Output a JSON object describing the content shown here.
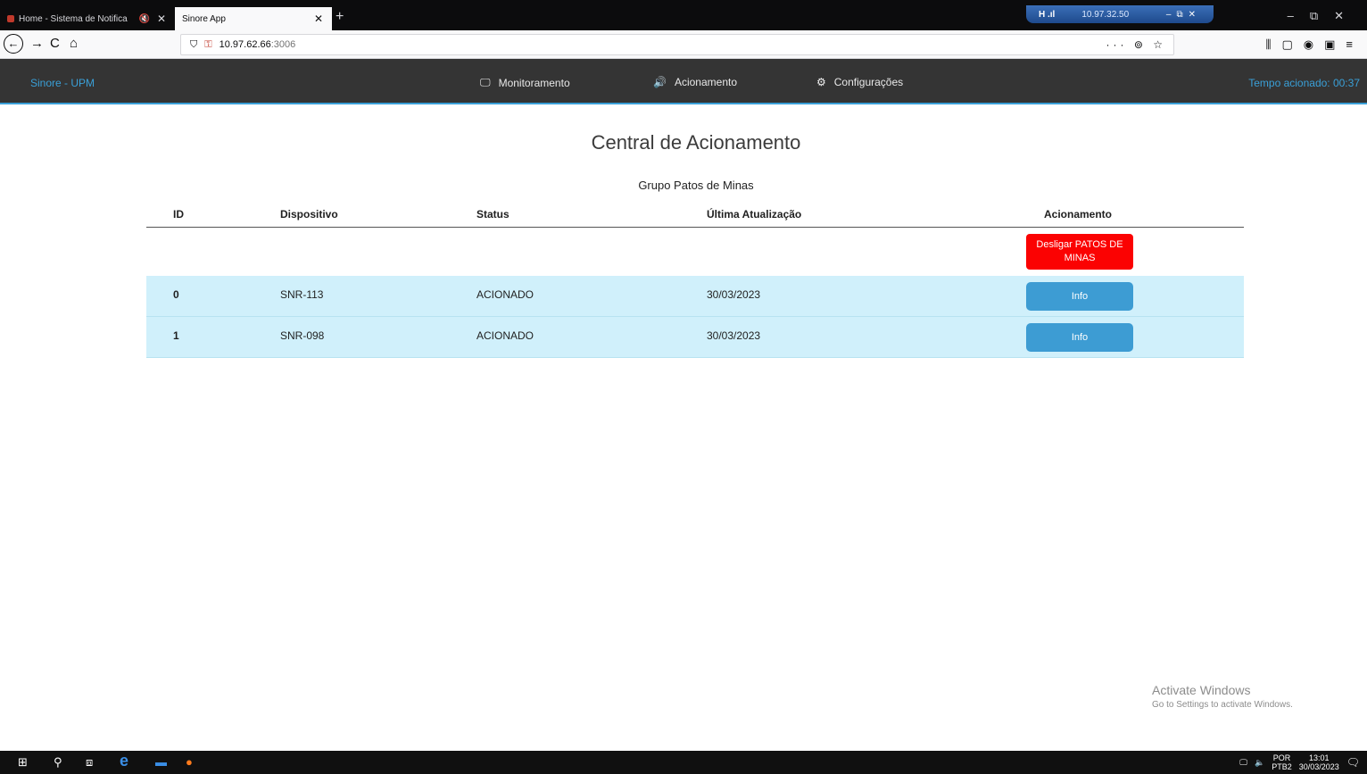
{
  "browser": {
    "tabs": [
      {
        "label": "Home - Sistema de Notifica",
        "active": false
      },
      {
        "label": "Sinore App",
        "active": true
      }
    ],
    "new_tab_icon": "+",
    "url_host": "10.97.62.66",
    "url_port": ":3006",
    "url_actions": "··· ⊚ ☆"
  },
  "remote_session": {
    "signal": "H .ıl",
    "ip": "10.97.32.50"
  },
  "app": {
    "brand": "Sinore - UPM",
    "nav": [
      {
        "label": "Monitoramento",
        "icon": "monitor-icon"
      },
      {
        "label": "Acionamento",
        "icon": "speaker-icon"
      },
      {
        "label": "Configurações",
        "icon": "gear-icon"
      }
    ],
    "timer": "Tempo acionado: 00:37"
  },
  "main": {
    "title": "Central de Acionamento",
    "group": "Grupo Patos de Minas",
    "columns": [
      "ID",
      "Dispositivo",
      "Status",
      "Última Atualização",
      "Acionamento"
    ],
    "shutdown_button": "Desligar PATOS DE MINAS",
    "rows": [
      {
        "id": "0",
        "device": "SNR-113",
        "status": "ACIONADO",
        "updated": "30/03/2023",
        "action": "Info"
      },
      {
        "id": "1",
        "device": "SNR-098",
        "status": "ACIONADO",
        "updated": "30/03/2023",
        "action": "Info"
      }
    ]
  },
  "watermark": {
    "line1": "Activate Windows",
    "line2": "Go to Settings to activate Windows."
  },
  "taskbar": {
    "lang_top": "POR",
    "lang_bottom": "PTB2",
    "time": "13:01",
    "date": "30/03/2023"
  },
  "colors": {
    "header_bg": "#343434",
    "accent": "#3aa0d8",
    "danger": "#fb0202",
    "row_bg": "#d0f0fb"
  }
}
